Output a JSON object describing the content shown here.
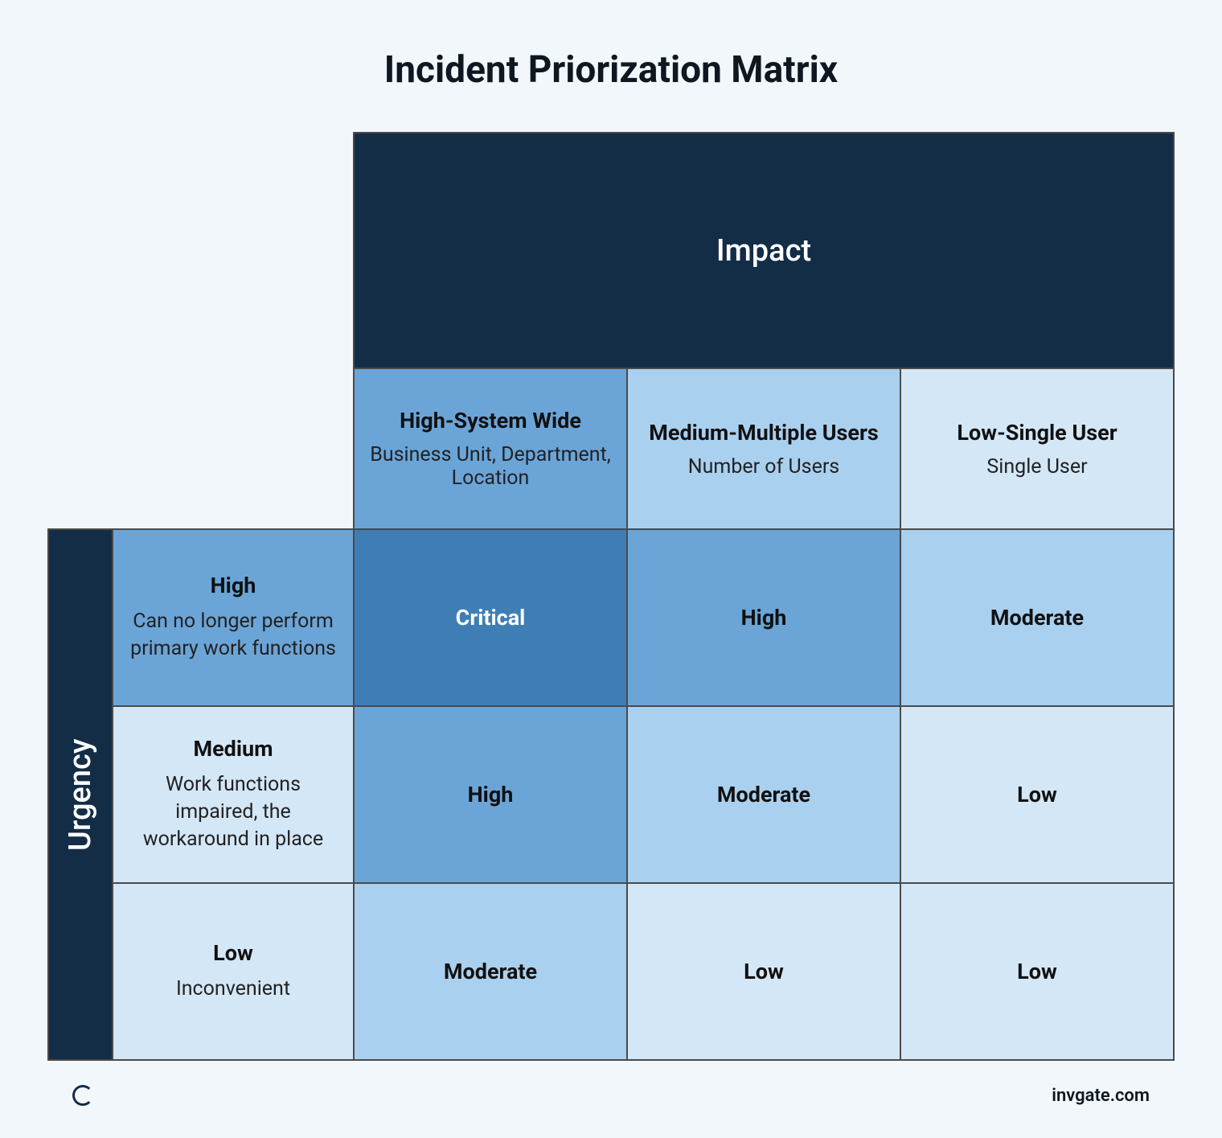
{
  "title": "Incident Priorization Matrix",
  "axes": {
    "x_label": "Impact",
    "y_label": "Urgency"
  },
  "impact_levels": [
    {
      "level": "High-System Wide",
      "desc": "Business Unit, Department, Location"
    },
    {
      "level": "Medium-Multiple Users",
      "desc": "Number of Users"
    },
    {
      "level": "Low-Single User",
      "desc": "Single User"
    }
  ],
  "urgency_levels": [
    {
      "level": "High",
      "desc": "Can no longer perform primary work functions"
    },
    {
      "level": "Medium",
      "desc": "Work functions impaired, the workaround in place"
    },
    {
      "level": "Low",
      "desc": "Inconvenient"
    }
  ],
  "cells": {
    "r0c0": "Critical",
    "r0c1": "High",
    "r0c2": "Moderate",
    "r1c0": "High",
    "r1c1": "Moderate",
    "r1c2": "Low",
    "r2c0": "Moderate",
    "r2c1": "Low",
    "r2c2": "Low"
  },
  "footer": {
    "brand": "invgate.com"
  }
}
